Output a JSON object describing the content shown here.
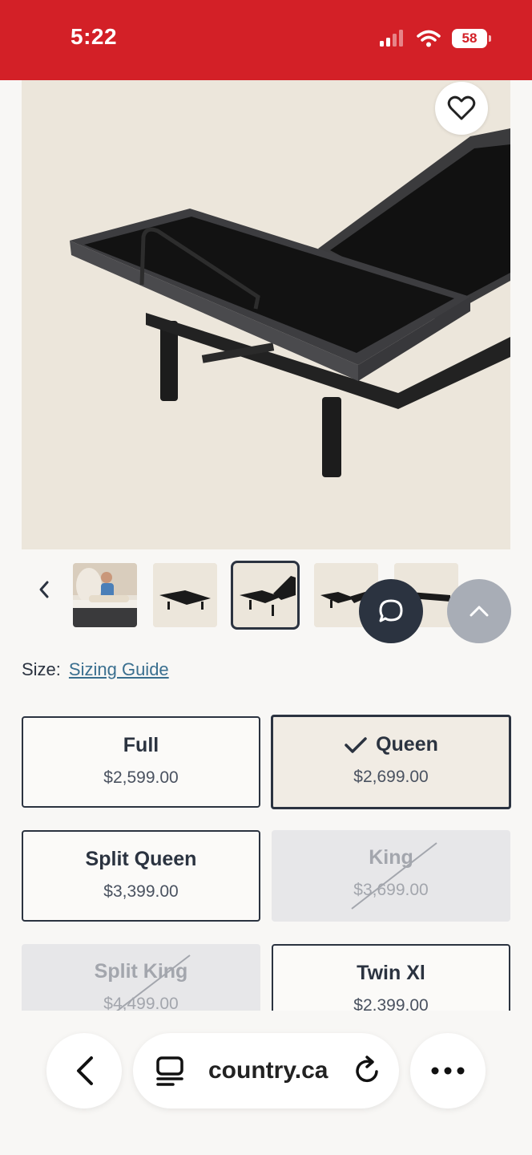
{
  "status_bar": {
    "time": "5:22",
    "battery": "58",
    "icons": [
      "signal-icon",
      "wifi-icon",
      "battery-icon"
    ],
    "color": "#d32027"
  },
  "product": {
    "gallery": {
      "icons": [
        "heart-icon",
        "chevron-left-icon"
      ],
      "thumbnail_count": 5,
      "selected_thumbnail": 3
    },
    "size_label": "Size:",
    "sizing_guide_link": "Sizing Guide",
    "options": [
      {
        "name": "Full",
        "price": "$2,599.00",
        "state": "available"
      },
      {
        "name": "Queen",
        "price": "$2,699.00",
        "state": "selected"
      },
      {
        "name": "Split Queen",
        "price": "$3,399.00",
        "state": "available"
      },
      {
        "name": "King",
        "price": "$3,699.00",
        "state": "unavailable"
      },
      {
        "name": "Split King",
        "price": "$4,499.00",
        "state": "unavailable"
      },
      {
        "name": "Twin Xl",
        "price": "$2,399.00",
        "state": "available"
      }
    ]
  },
  "floating": {
    "icons": [
      "chat-icon",
      "chevron-up-icon"
    ]
  },
  "browser": {
    "url": "country.ca",
    "icons": [
      "back-icon",
      "tabs-icon",
      "reload-icon",
      "more-icon"
    ]
  }
}
